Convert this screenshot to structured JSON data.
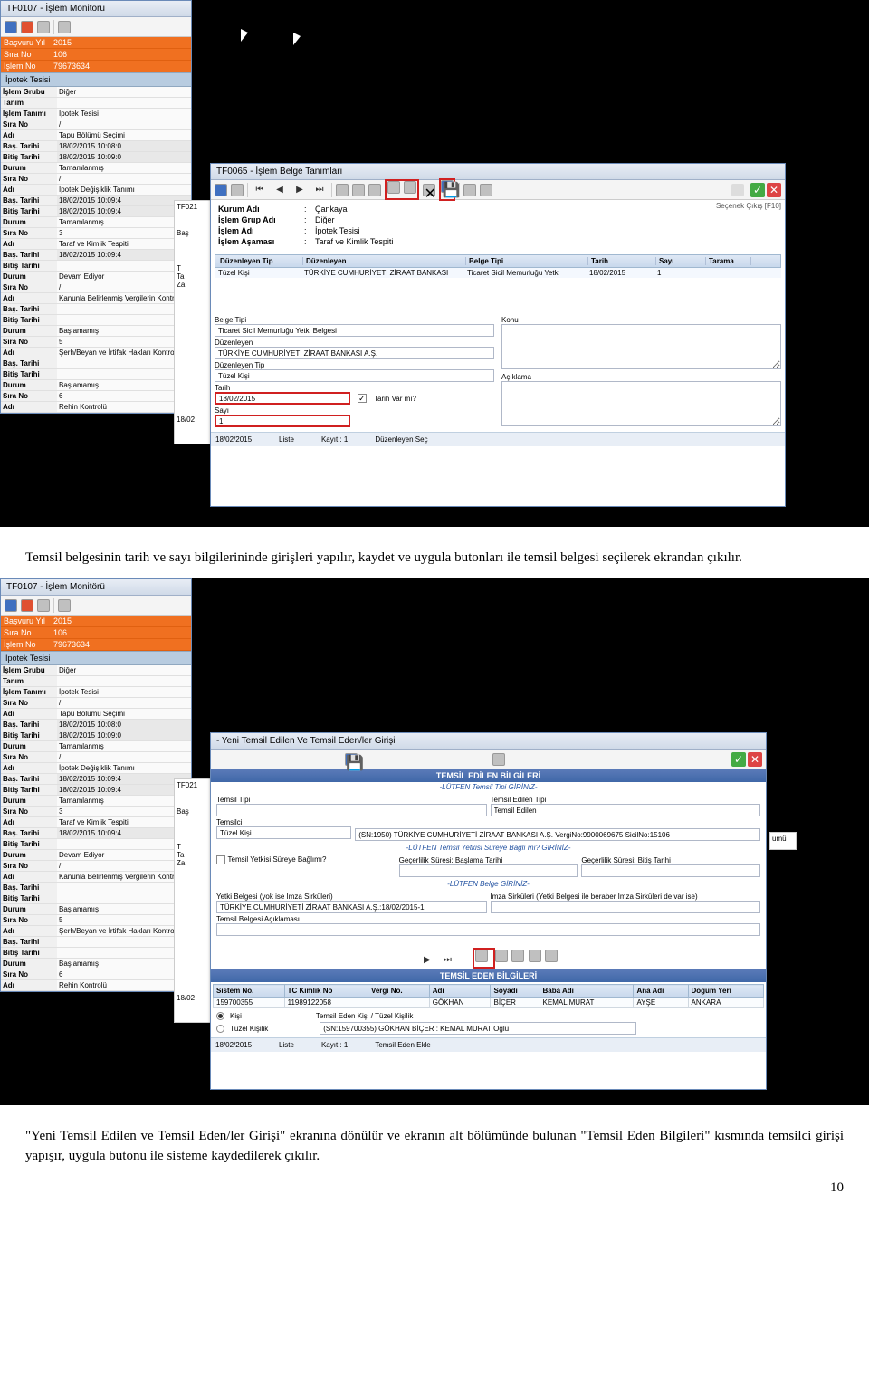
{
  "monitor_title": "TF0107 - İşlem Monitörü",
  "kv": {
    "basvuru_yil_k": "Başvuru Yıl",
    "basvuru_yil_v": "2015",
    "sira_no_k": "Sıra No",
    "sira_no_v": "106",
    "islem_no_k": "İşlem No",
    "islem_no_v": "79673634"
  },
  "ipotek": "İpotek Tesisi",
  "grid_labels": {
    "islem_grubu": "İşlem Grubu",
    "tanim": "Tanım",
    "islem_tanimi": "İşlem Tanımı",
    "sira_no": "Sıra No",
    "adi": "Adı",
    "bas_tarihi": "Baş. Tarihi",
    "bitis_tarihi": "Bitiş Tarihi",
    "durum": "Durum"
  },
  "grid_values": {
    "diger": "Diğer",
    "ipotek_tesisi": "İpotek Tesisi",
    "slash": "/",
    "tapu_bolumu": "Tapu Bölümü Seçimi",
    "dt1": "18/02/2015 10:08:0",
    "dt2": "18/02/2015 10:09:0",
    "dt3": "18/02/2015 10:09:4",
    "dt4": "18/02/2015 10:09:4",
    "dt5": "18/02/2015 10:09:4",
    "tamamlanmis": "Tamamlanmış",
    "devam": "Devam Ediyor",
    "baslamamis": "Başlamamış",
    "ipotek_deg": "İpotek Değişiklik Tanımı",
    "taraf": "Taraf ve Kimlik Tespiti",
    "kanunla": "Kanunla Belirlenmiş Vergilerin Kontrolü",
    "serh": "Şerh/Beyan ve İrtifak Hakları Kontrolü",
    "rehin": "Rehin Kontrolü",
    "three": "3",
    "five": "5",
    "six": "6"
  },
  "tf0065": {
    "title": "TF0065 - İşlem Belge Tanımları",
    "kurum_k": "Kurum Adı",
    "kurum_v": "Çankaya",
    "grup_k": "İşlem Grup Adı",
    "grup_v": "Diğer",
    "islem_k": "İşlem Adı",
    "islem_v": "İpotek Tesisi",
    "asama_k": "İşlem Aşaması",
    "asama_v": "Taraf ve Kimlik Tespiti",
    "secenek": "Seçenek Çıkış [F10]",
    "cols": {
      "duzenleyen_tip": "Düzenleyen Tip",
      "duzenleyen": "Düzenleyen",
      "belge_tipi": "Belge Tipi",
      "tarih": "Tarih",
      "sayi": "Sayı",
      "tarama": "Tarama"
    },
    "row": {
      "tip": "Tüzel Kişi",
      "duz": "TÜRKİYE CUMHURİYETİ ZİRAAT BANKASI",
      "belge": "Ticaret Sicil Memurluğu Yetki",
      "tarih": "18/02/2015",
      "sayi": "1"
    },
    "form": {
      "belge_tipi_l": "Belge Tipi",
      "belge_tipi_v": "Ticaret Sicil Memurluğu Yetki Belgesi",
      "duz_l": "Düzenleyen",
      "duz_v": "TÜRKİYE CUMHURİYETİ ZİRAAT BANKASI A.Ş.",
      "duz_tip_l": "Düzenleyen Tip",
      "duz_tip_v": "Tüzel Kişi",
      "tarih_l": "Tarih",
      "tarih_v": "18/02/2015",
      "tarih_var": "Tarih Var mı?",
      "sayi_l": "Sayı",
      "sayi_v": "1",
      "konu_l": "Konu",
      "aciklama_l": "Açıklama"
    },
    "status": {
      "date": "18/02/2015",
      "liste": "Liste",
      "kayit": "Kayıt : 1",
      "sec": "Düzenleyen Seç"
    }
  },
  "yeni_temsil": {
    "title": "- Yeni Temsil Edilen Ve Temsil Eden/ler Girişi",
    "band1": "TEMSİL EDİLEN BİLGİLERİ",
    "instr1": "-LÜTFEN Temsil Tipi GİRİNİZ-",
    "temsil_tipi_l": "Temsil Tipi",
    "temsil_edilen_tip_l": "Temsil Edilen Tipi",
    "temsil_edilen_tip_v": "Temsil Edilen",
    "temsilci_l": "Temsilci",
    "temsilci_tip_v": "Tüzel Kişi",
    "temsilci_v": "(SN:1950) TÜRKİYE CUMHURİYETİ ZİRAAT BANKASI A.Ş. VergiNo:9900069675 SicilNo:15106",
    "instr2": "-LÜTFEN Temsil Yetkisi Süreye Bağlı mı? GİRİNİZ-",
    "sureye_bagli": "Temsil Yetkisi Süreye Bağlımı?",
    "gec_bas": "Geçerlilik Süresi: Başlama Tarihi",
    "gec_bit": "Geçerlilik Süresi: Bitiş Tarihi",
    "instr3": "-LÜTFEN Belge GİRİNİZ-",
    "yetki_l": "Yetki Belgesi (yok ise İmza Sirküleri)",
    "yetki_v": "TÜRKİYE CUMHURİYETİ ZİRAAT BANKASI A.Ş.:18/02/2015-1",
    "imza_l": "İmza Sirküleri (Yetki Belgesi ile beraber İmza Sirküleri de var ise)",
    "aciklama_l": "Temsil Belgesi Açıklaması",
    "band2": "TEMSİL EDEN BİLGİLERİ",
    "cols": {
      "sistem": "Sistem No.",
      "tc": "TC Kimlik No",
      "vergi": "Vergi No.",
      "adi": "Adı",
      "soyadi": "Soyadı",
      "baba": "Baba Adı",
      "ana": "Ana Adı",
      "dogum": "Doğum Yeri"
    },
    "row": {
      "sistem": "159700355",
      "tc": "11989122058",
      "adi": "GÖKHAN",
      "soyadi": "BİÇER",
      "baba": "KEMAL MURAT",
      "ana": "AYŞE",
      "dogum": "ANKARA"
    },
    "kisi": "Kişi",
    "tuzel": "Tüzel Kişilik",
    "temsil_eden_line": "Temsil Eden Kişi / Tüzel Kişilik",
    "temsil_eden_v": "(SN:159700355) GÖKHAN BİÇER : KEMAL MURAT Oğlu",
    "status_date": "18/02/2015",
    "status_liste": "Liste",
    "status_kayit": "Kayıt : 1",
    "status_ekle": "Temsil Eden Ekle"
  },
  "frag": {
    "tf021": "TF021",
    "bas": "Baş",
    "t": "T",
    "ta": "Ta",
    "za": "Za",
    "slash18": "18/02",
    "umu": "umü"
  },
  "paragraph1": "Temsil belgesinin tarih ve sayı bilgilerininde girişleri yapılır, kaydet ve uygula butonları ile temsil belgesi seçilerek ekrandan çıkılır.",
  "paragraph2": "\"Yeni Temsil Edilen ve Temsil Eden/ler Girişi\" ekranına dönülür ve ekranın alt bölümünde bulunan \"Temsil Eden Bilgileri\" kısmında temsilci girişi yapışır, uygula butonu ile sisteme kaydedilerek çıkılır.",
  "page_num": "10"
}
